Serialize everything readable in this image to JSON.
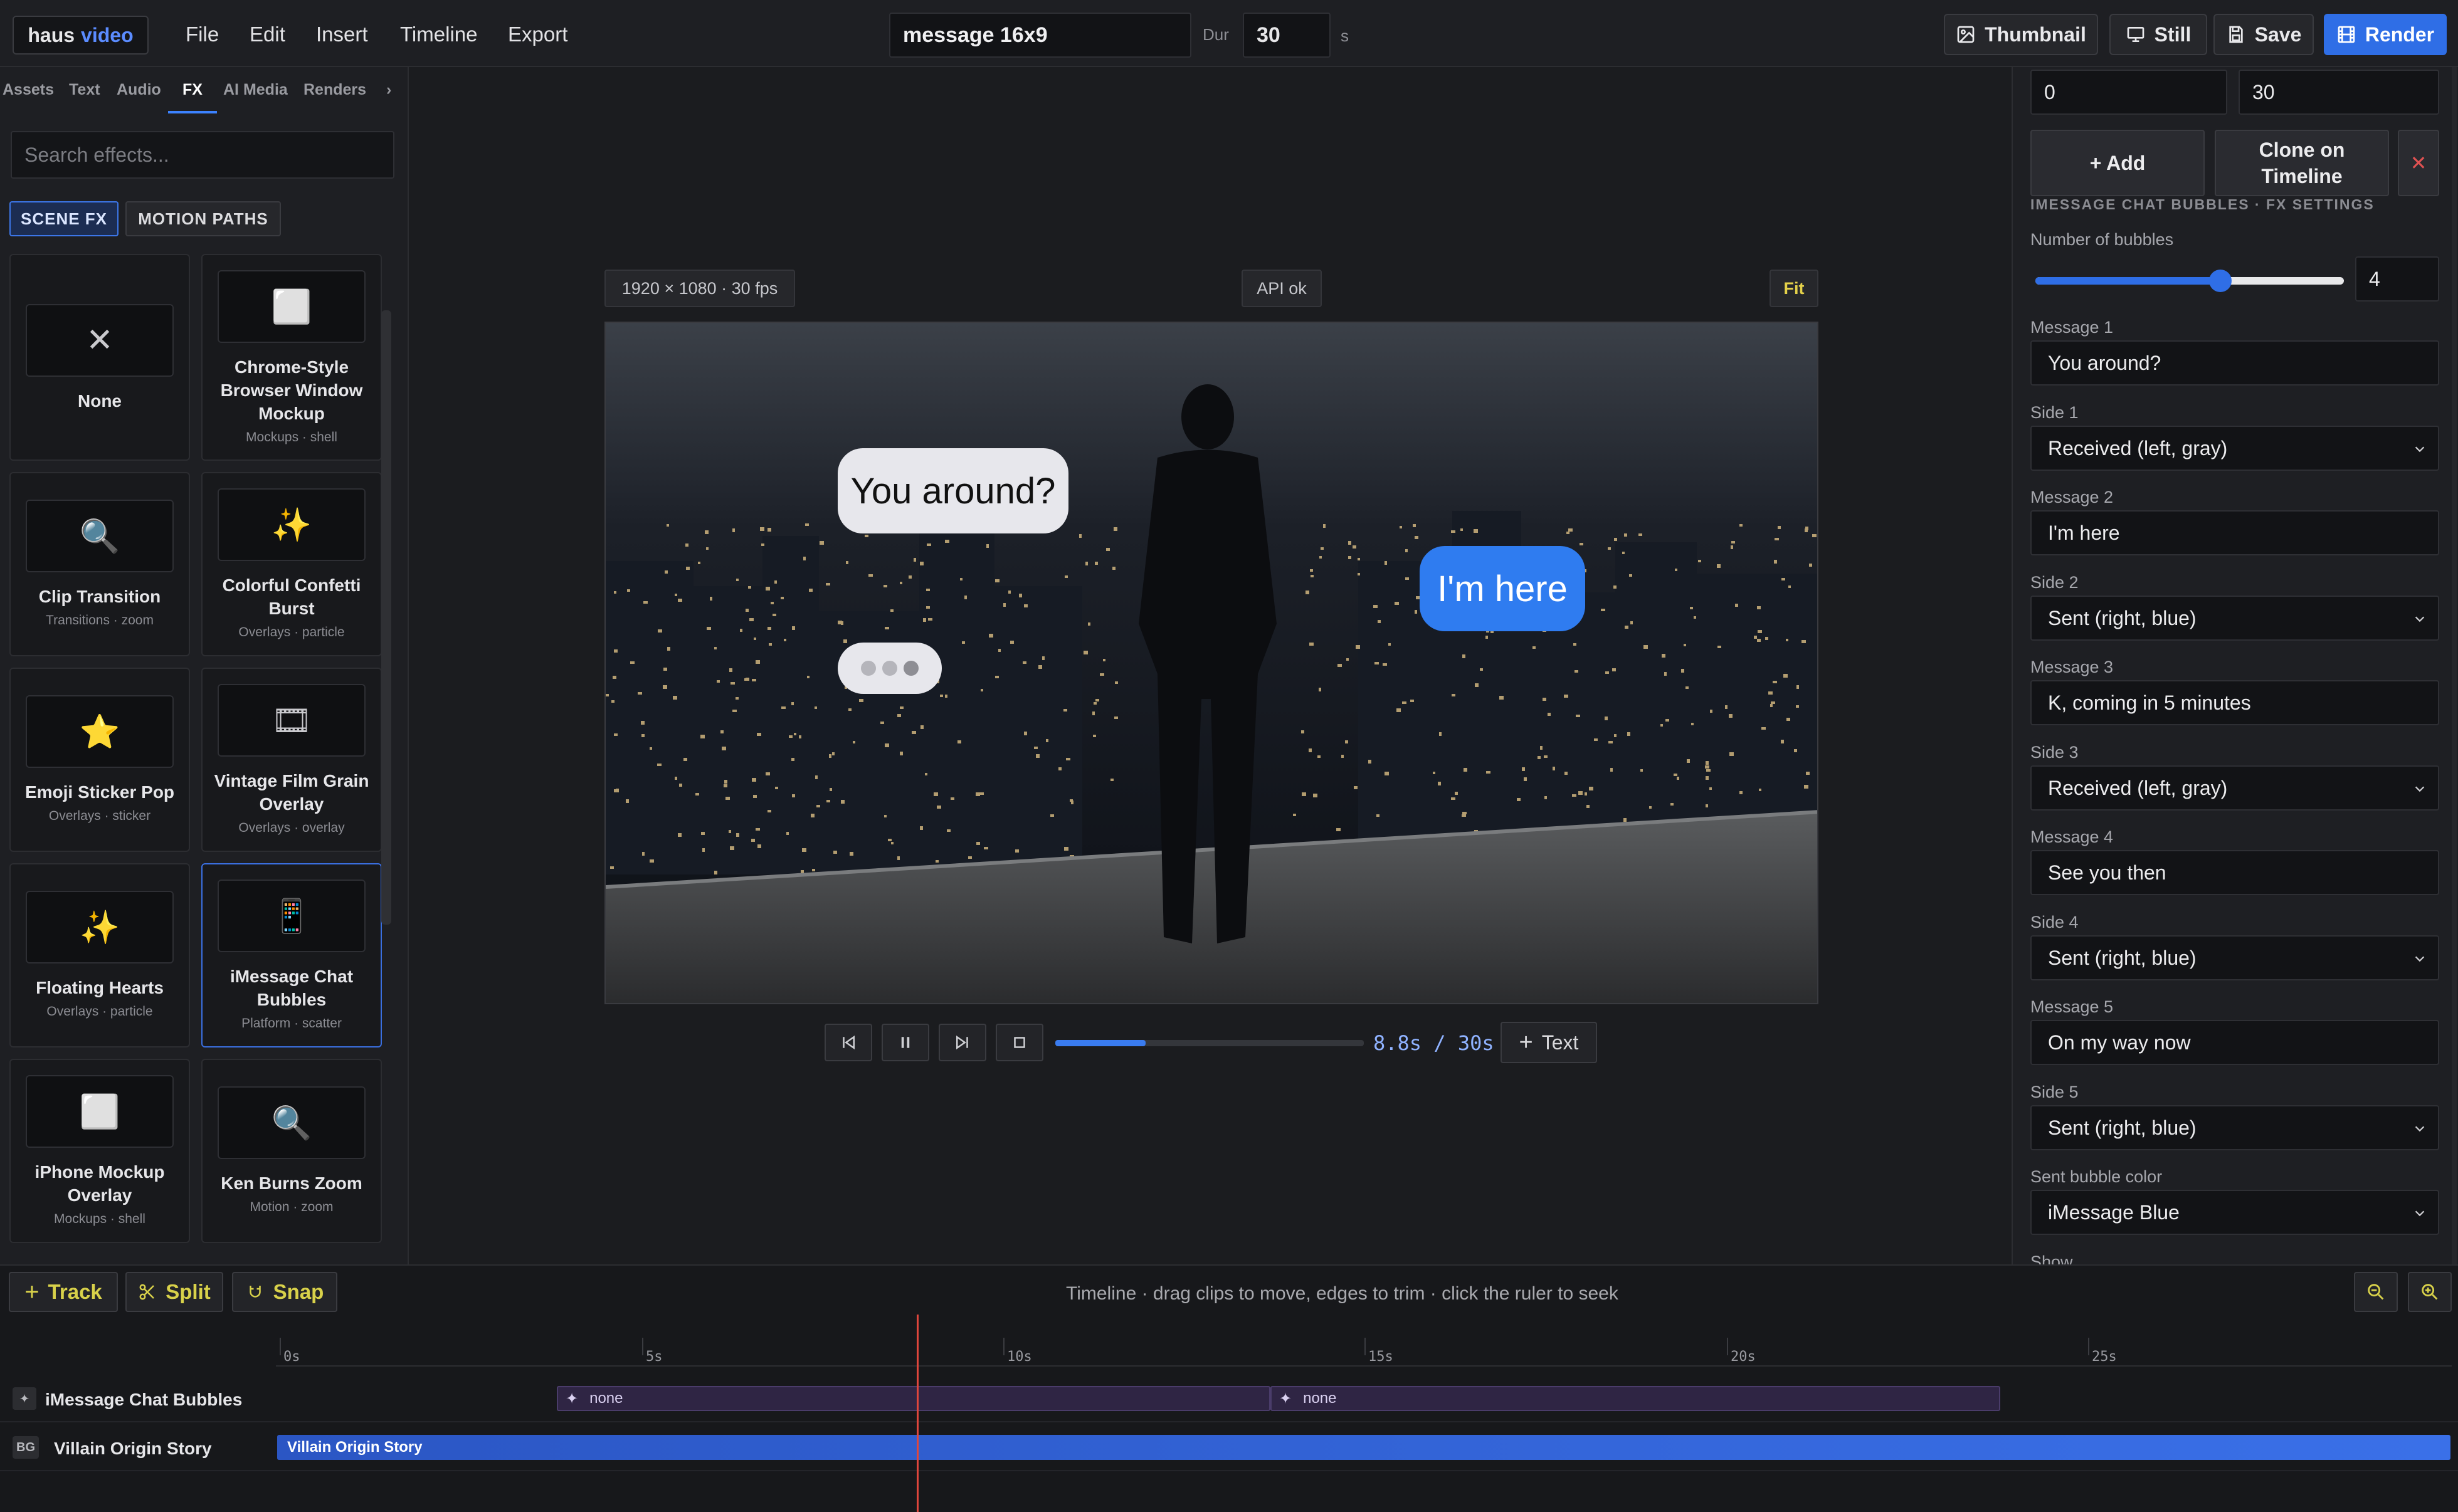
{
  "app": {
    "logo_main": "haus",
    "logo_accent": "video",
    "menu": [
      "File",
      "Edit",
      "Insert",
      "Timeline",
      "Export"
    ],
    "project_title": "message 16x9",
    "duration_label": "Dur",
    "duration_value": "30",
    "duration_unit": "s",
    "actions": {
      "thumbnail": "Thumbnail",
      "still": "Still",
      "save": "Save",
      "render": "Render"
    }
  },
  "left_panel": {
    "tabs": [
      "Assets",
      "Text",
      "Audio",
      "FX",
      "AI Media",
      "Renders",
      "›"
    ],
    "active_tab": "FX",
    "search_placeholder": "Search effects...",
    "chips": {
      "scene_fx": "SCENE FX",
      "motion_paths": "MOTION PATHS"
    },
    "effects": [
      {
        "title": "None",
        "subtitle": "",
        "icon": "✕"
      },
      {
        "title": "Chrome-Style Browser Window Mockup",
        "subtitle": "Mockups · shell",
        "icon": "⬜"
      },
      {
        "title": "Clip Transition",
        "subtitle": "Transitions · zoom",
        "icon": "🔍"
      },
      {
        "title": "Colorful Confetti Burst",
        "subtitle": "Overlays · particle",
        "icon": "✨"
      },
      {
        "title": "Emoji Sticker Pop",
        "subtitle": "Overlays · sticker",
        "icon": "⭐"
      },
      {
        "title": "Vintage Film Grain Overlay",
        "subtitle": "Overlays · overlay",
        "icon": "🎞"
      },
      {
        "title": "Floating Hearts",
        "subtitle": "Overlays · particle",
        "icon": "✨"
      },
      {
        "title": "iMessage Chat Bubbles",
        "subtitle": "Platform · scatter",
        "icon": "📱"
      },
      {
        "title": "iPhone Mockup Overlay",
        "subtitle": "Mockups · shell",
        "icon": "⬜"
      },
      {
        "title": "Ken Burns Zoom",
        "subtitle": "Motion · zoom",
        "icon": "🔍"
      }
    ]
  },
  "stage": {
    "resolution": "1920 × 1080 · 30 fps",
    "api_status": "API ok",
    "fit_label": "Fit",
    "bubble1": "You around?",
    "bubble2": "I'm here",
    "timecode": "8.8s / 30s",
    "progress": 0.293,
    "add_text": "Text"
  },
  "right_panel": {
    "start_value": "0",
    "end_value": "30",
    "add_button": "+ Add",
    "clone_button": "Clone on Timeline",
    "section_title": "IMESSAGE CHAT BUBBLES · FX SETTINGS",
    "bubbles_label": "Number of bubbles",
    "bubbles_value": "4",
    "bubbles_slider": 0.6,
    "fields": [
      {
        "label": "Message 1",
        "value": "You around?",
        "kind": "input"
      },
      {
        "label": "Side 1",
        "value": "Received (left, gray)",
        "kind": "select"
      },
      {
        "label": "Message 2",
        "value": "I'm here",
        "kind": "input"
      },
      {
        "label": "Side 2",
        "value": "Sent (right, blue)",
        "kind": "select"
      },
      {
        "label": "Message 3",
        "value": "K, coming in 5 minutes",
        "kind": "input"
      },
      {
        "label": "Side 3",
        "value": "Received (left, gray)",
        "kind": "select"
      },
      {
        "label": "Message 4",
        "value": "See you then",
        "kind": "input"
      },
      {
        "label": "Side 4",
        "value": "Sent (right, blue)",
        "kind": "select"
      },
      {
        "label": "Message 5",
        "value": "On my way now",
        "kind": "input"
      },
      {
        "label": "Side 5",
        "value": "Sent (right, blue)",
        "kind": "select"
      },
      {
        "label": "Sent bubble color",
        "value": "iMessage Blue",
        "kind": "select"
      },
      {
        "label": "Show",
        "value": "",
        "kind": "label"
      }
    ]
  },
  "timeline": {
    "track_button": "Track",
    "split_button": "Split",
    "snap_button": "Snap",
    "hint": "Timeline · drag clips to move, edges to trim · click the ruler to seek",
    "ruler_labels": [
      "0s",
      "5s",
      "10s",
      "15s",
      "20s",
      "25s"
    ],
    "tracks": [
      {
        "tag": "✦",
        "name": "iMessage Chat Bubbles",
        "clips": [
          "none",
          "none"
        ]
      },
      {
        "tag": "BG",
        "name": "Villain Origin Story",
        "clips": [
          "Villain Origin Story"
        ]
      }
    ]
  }
}
